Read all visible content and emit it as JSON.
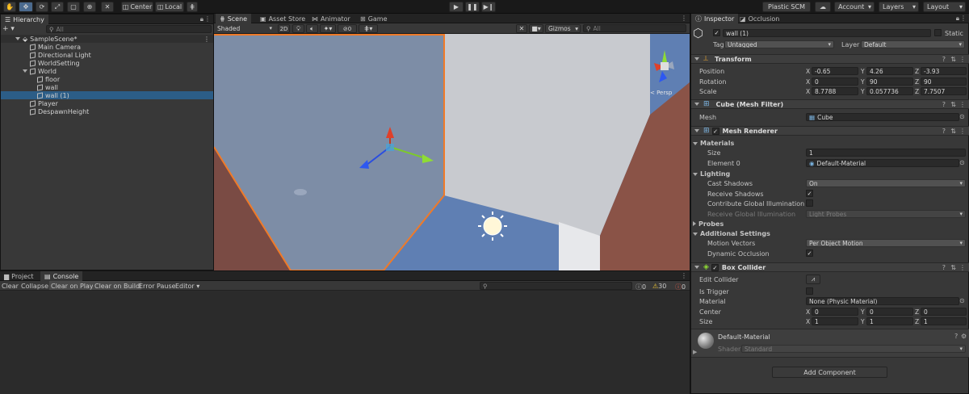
{
  "toolbar": {
    "center_label": "Center",
    "local_label": "Local",
    "plastic_label": "Plastic SCM",
    "account_label": "Account",
    "layers_label": "Layers",
    "layout_label": "Layout"
  },
  "hierarchy": {
    "tab_label": "Hierarchy",
    "search_placeholder": "All",
    "items": [
      {
        "label": "SampleScene*"
      },
      {
        "label": "Main Camera"
      },
      {
        "label": "Directional Light"
      },
      {
        "label": "WorldSetting"
      },
      {
        "label": "World"
      },
      {
        "label": "floor"
      },
      {
        "label": "wall"
      },
      {
        "label": "wall (1)"
      },
      {
        "label": "Player"
      },
      {
        "label": "DespawnHeight"
      }
    ]
  },
  "scene": {
    "tabs": [
      "Scene",
      "Asset Store",
      "Animator",
      "Game"
    ],
    "shading_mode": "Shaded",
    "mode_2d": "2D",
    "hidden_count": "0",
    "gizmos_label": "Gizmos",
    "search_placeholder": "All",
    "persp_label": "< Persp"
  },
  "console": {
    "tabs": [
      "Project",
      "Console"
    ],
    "buttons": [
      "Clear",
      "Collapse",
      "Clear on Play",
      "Clear on Build",
      "Error Pause",
      "Editor"
    ],
    "log_count": "0",
    "warn_count": "30",
    "error_count": "0"
  },
  "inspector": {
    "tabs": [
      "Inspector",
      "Occlusion"
    ],
    "object_name": "wall (1)",
    "static_label": "Static",
    "tag_label": "Tag",
    "tag_value": "Untagged",
    "layer_label": "Layer",
    "layer_value": "Default",
    "transform": {
      "title": "Transform",
      "position_label": "Position",
      "rotation_label": "Rotation",
      "scale_label": "Scale",
      "position": [
        "-0.65",
        "4.26",
        "-3.93"
      ],
      "rotation": [
        "0",
        "90",
        "90"
      ],
      "scale": [
        "8.7788",
        "0.057736",
        "7.7507"
      ]
    },
    "mesh_filter": {
      "title": "Cube (Mesh Filter)",
      "mesh_label": "Mesh",
      "mesh_value": "Cube"
    },
    "mesh_renderer": {
      "title": "Mesh Renderer",
      "materials_label": "Materials",
      "size_label": "Size",
      "size_value": "1",
      "element0_label": "Element 0",
      "element0_value": "Default-Material",
      "lighting_label": "Lighting",
      "cast_shadows_label": "Cast Shadows",
      "cast_shadows_value": "On",
      "receive_shadows_label": "Receive Shadows",
      "contribute_gi_label": "Contribute Global Illumination",
      "receive_gi_label": "Receive Global Illumination",
      "receive_gi_value": "Light Probes",
      "probes_label": "Probes",
      "additional_label": "Additional Settings",
      "motion_vectors_label": "Motion Vectors",
      "motion_vectors_value": "Per Object Motion",
      "dynamic_occlusion_label": "Dynamic Occlusion"
    },
    "box_collider": {
      "title": "Box Collider",
      "edit_collider_label": "Edit Collider",
      "is_trigger_label": "Is Trigger",
      "material_label": "Material",
      "material_value": "None (Physic Material)",
      "center_label": "Center",
      "size_label": "Size",
      "center": [
        "0",
        "0",
        "0"
      ],
      "size": [
        "1",
        "1",
        "1"
      ]
    },
    "material_preview": {
      "name": "Default-Material",
      "shader_label": "Shader",
      "shader_value": "Standard"
    },
    "add_component_label": "Add Component"
  },
  "colors": {
    "selection": "#2c5d87",
    "panel": "#383838",
    "outline": "#f07a28"
  }
}
